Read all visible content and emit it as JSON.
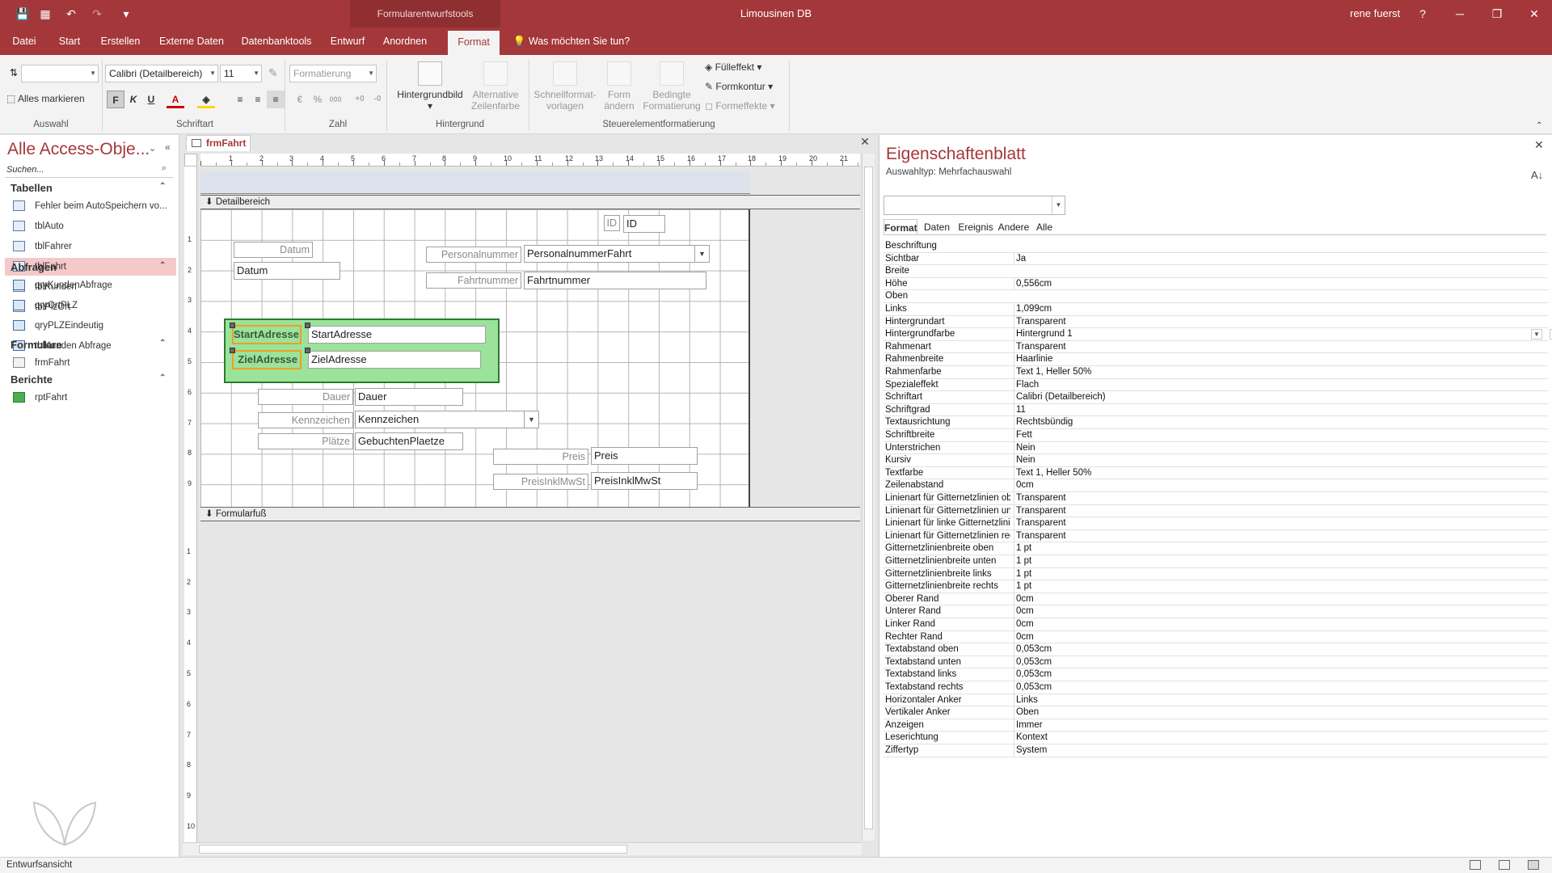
{
  "titlebar": {
    "context_tab": "Formularentwurfstools",
    "title": "Limousinen DB",
    "user": "rene fuerst",
    "help": "?",
    "minimize": "─",
    "restore": "❐",
    "close": "✕"
  },
  "qat": {
    "save": "💾",
    "form_view": "▦",
    "undo": "↶",
    "redo": "↷",
    "customize": "▾"
  },
  "ribbon_tabs": {
    "datei": "Datei",
    "start": "Start",
    "erstellen": "Erstellen",
    "externe_daten": "Externe Daten",
    "datenbanktools": "Datenbanktools",
    "entwurf": "Entwurf",
    "anordnen": "Anordnen",
    "format": "Format",
    "tell_me": "Was möchten Sie tun?"
  },
  "ribbon": {
    "select_all": "Alles markieren",
    "font_name": "Calibri (Detailbereich)",
    "font_size": "11",
    "number_format": "Formatierung",
    "bold": "F",
    "italic": "K",
    "underline": "U",
    "font_color": "A",
    "percent": "%",
    "thousands": "000",
    "bg_image": "Hintergrundbild",
    "alt_row_color_1": "Alternative",
    "alt_row_color_2": "Zeilenfarbe",
    "quick_styles_1": "Schnellformat-",
    "quick_styles_2": "vorlagen",
    "change_shape_1": "Form",
    "change_shape_2": "ändern",
    "cond_format_1": "Bedingte",
    "cond_format_2": "Formatierung",
    "fill": "Fülleffekt",
    "outline": "Formkontur",
    "effects": "Formeffekte",
    "groups": {
      "selection": "Auswahl",
      "font": "Schriftart",
      "number": "Zahl",
      "background": "Hintergrund",
      "control_format": "Steuerelementformatierung"
    }
  },
  "nav": {
    "title": "Alle Access-Obje...",
    "search_placeholder": "Suchen...",
    "sections": [
      {
        "label": "Tabellen",
        "items": [
          "Fehler beim AutoSpeichern vo...",
          "tblAuto",
          "tblFahrer",
          "tblFahrt",
          "tblKunden",
          "tblPlzOrt"
        ]
      },
      {
        "label": "Abfragen",
        "items": [
          "qryKundenAbfrage",
          "qryOrtPLZ",
          "qryPLZEindeutig",
          "tblKunden Abfrage"
        ]
      },
      {
        "label": "Formulare",
        "items": [
          "frmFahrt"
        ]
      },
      {
        "label": "Berichte",
        "items": [
          "rptFahrt"
        ]
      }
    ]
  },
  "document": {
    "tab": "frmFahrt",
    "ruler_numbers": [
      "1",
      "2",
      "3",
      "4",
      "5",
      "6",
      "7",
      "8",
      "9",
      "10",
      "11",
      "12",
      "13",
      "14",
      "15",
      "16",
      "17",
      "18",
      "19",
      "20",
      "21"
    ],
    "vruler_numbers": [
      "1",
      "2",
      "3",
      "4",
      "5",
      "6",
      "7",
      "8",
      "9"
    ],
    "vruler_numbers_footer": [
      "1",
      "2",
      "3",
      "4",
      "5",
      "6",
      "7",
      "8",
      "9",
      "10"
    ],
    "detail_band": "Detailbereich",
    "footer_band": "Formularfuß",
    "controls": {
      "id_label": "ID",
      "id_text": "ID",
      "datum_label": "Datum",
      "datum_text": "Datum",
      "personalnummer_label": "Personalnummer",
      "personalnummer_combo": "PersonalnummerFahrt",
      "fahrtnummer_label": "Fahrtnummer",
      "fahrtnummer_text": "Fahrtnummer",
      "startadresse_label": "StartAdresse",
      "startadresse_text": "StartAdresse",
      "zieladresse_label": "ZielAdresse",
      "zieladresse_text": "ZielAdresse",
      "dauer_label": "Dauer",
      "dauer_text": "Dauer",
      "kennzeichen_label": "Kennzeichen",
      "kennzeichen_combo": "Kennzeichen",
      "plaetze_label": "Plätze",
      "plaetze_text": "GebuchtenPlaetze",
      "preis_label": "Preis",
      "preis_text": "Preis",
      "preisinkl_label": "PreisInklMwSt",
      "preisinkl_text": "PreisInklMwSt"
    }
  },
  "properties": {
    "title": "Eigenschaftenblatt",
    "selection_type": "Auswahltyp:  Mehrfachauswahl",
    "tabs": [
      "Format",
      "Daten",
      "Ereignis",
      "Andere",
      "Alle"
    ],
    "rows": [
      [
        "Beschriftung",
        ""
      ],
      [
        "Sichtbar",
        "Ja"
      ],
      [
        "Breite",
        ""
      ],
      [
        "Höhe",
        "0,556cm"
      ],
      [
        "Oben",
        ""
      ],
      [
        "Links",
        "1,099cm"
      ],
      [
        "Hintergrundart",
        "Transparent"
      ],
      [
        "Hintergrundfarbe",
        "Hintergrund 1"
      ],
      [
        "Rahmenart",
        "Transparent"
      ],
      [
        "Rahmenbreite",
        "Haarlinie"
      ],
      [
        "Rahmenfarbe",
        "Text 1, Heller 50%"
      ],
      [
        "Spezialeffekt",
        "Flach"
      ],
      [
        "Schriftart",
        "Calibri (Detailbereich)"
      ],
      [
        "Schriftgrad",
        "11"
      ],
      [
        "Textausrichtung",
        "Rechtsbündig"
      ],
      [
        "Schriftbreite",
        "Fett"
      ],
      [
        "Unterstrichen",
        "Nein"
      ],
      [
        "Kursiv",
        "Nein"
      ],
      [
        "Textfarbe",
        "Text 1, Heller 50%"
      ],
      [
        "Zeilenabstand",
        "0cm"
      ],
      [
        "Linienart für Gitternetzlinien oben",
        "Transparent"
      ],
      [
        "Linienart für Gitternetzlinien unten",
        "Transparent"
      ],
      [
        "Linienart für linke Gitternetzlinien",
        "Transparent"
      ],
      [
        "Linienart für Gitternetzlinien rechts",
        "Transparent"
      ],
      [
        "Gitternetzlinienbreite oben",
        "1 pt"
      ],
      [
        "Gitternetzlinienbreite unten",
        "1 pt"
      ],
      [
        "Gitternetzlinienbreite links",
        "1 pt"
      ],
      [
        "Gitternetzlinienbreite rechts",
        "1 pt"
      ],
      [
        "Oberer Rand",
        "0cm"
      ],
      [
        "Unterer Rand",
        "0cm"
      ],
      [
        "Linker Rand",
        "0cm"
      ],
      [
        "Rechter Rand",
        "0cm"
      ],
      [
        "Textabstand oben",
        "0,053cm"
      ],
      [
        "Textabstand unten",
        "0,053cm"
      ],
      [
        "Textabstand links",
        "0,053cm"
      ],
      [
        "Textabstand rechts",
        "0,053cm"
      ],
      [
        "Horizontaler Anker",
        "Links"
      ],
      [
        "Vertikaler Anker",
        "Oben"
      ],
      [
        "Anzeigen",
        "Immer"
      ],
      [
        "Leserichtung",
        "Kontext"
      ],
      [
        "Ziffertyp",
        "System"
      ]
    ]
  },
  "status": {
    "text": "Entwurfsansicht"
  },
  "colors": {
    "accent": "#a4373a",
    "selection_group": "#9be29b",
    "selected_nav": "#f5c8ca"
  }
}
